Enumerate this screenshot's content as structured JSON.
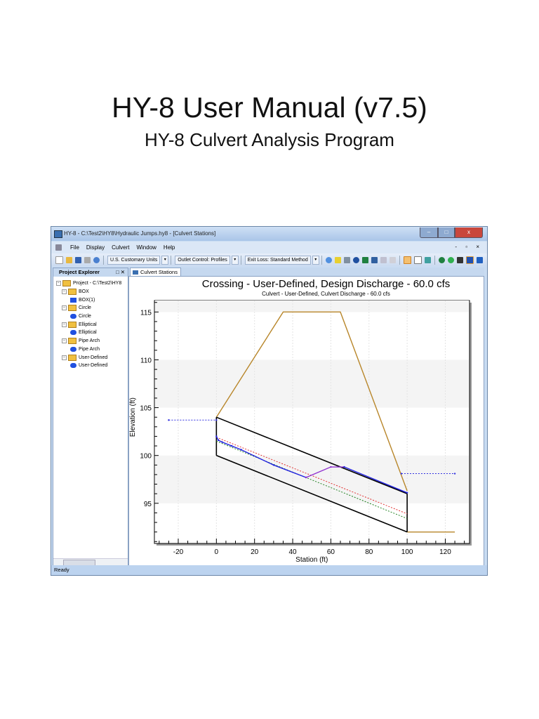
{
  "document": {
    "title": "HY-8 User Manual (v7.5)",
    "subtitle": "HY-8 Culvert Analysis Program"
  },
  "window": {
    "title": "HY-8 - C:\\Test2\\HY8\\Hydraulic Jumps.hy8 - [Culvert Stations]",
    "controls": [
      "minimize",
      "maximize",
      "close"
    ]
  },
  "menu": [
    "File",
    "Display",
    "Culvert",
    "Window",
    "Help"
  ],
  "toolbar": {
    "units": "U.S. Customary Units",
    "profiles": "Outlet Control: Profiles",
    "exit_loss": "Exit Loss: Standard Method"
  },
  "explorer": {
    "title": "Project Explorer",
    "items": [
      {
        "label": "Project - C:\\Test2\\HY8",
        "level": 0,
        "type": "folder"
      },
      {
        "label": "BOX",
        "level": 1,
        "type": "folder"
      },
      {
        "label": "BOX(1)",
        "level": 2,
        "type": "box"
      },
      {
        "label": "Circle",
        "level": 1,
        "type": "folder"
      },
      {
        "label": "Circle",
        "level": 2,
        "type": "ball"
      },
      {
        "label": "Elliptical",
        "level": 1,
        "type": "folder"
      },
      {
        "label": "Elliptical",
        "level": 2,
        "type": "ball"
      },
      {
        "label": "Pipe Arch",
        "level": 1,
        "type": "folder"
      },
      {
        "label": "Pipe Arch",
        "level": 2,
        "type": "ball"
      },
      {
        "label": "User-Defined",
        "level": 1,
        "type": "folder"
      },
      {
        "label": "User-Defined",
        "level": 2,
        "type": "ball"
      }
    ]
  },
  "tab": "Culvert Stations",
  "status": "Ready",
  "chart_data": {
    "type": "line",
    "title": "Crossing - User-Defined, Design Discharge - 60.0 cfs",
    "subtitle": "Culvert - User-Defined, Culvert Discharge - 60.0 cfs",
    "xlabel": "Station (ft)",
    "ylabel": "Elevation (ft)",
    "xlim": [
      -32.5,
      132.7
    ],
    "ylim": [
      90.8,
      116.2
    ],
    "xticks": [
      -20,
      0,
      20,
      40,
      60,
      80,
      100,
      120
    ],
    "yticks": [
      95,
      100,
      105,
      110,
      115
    ],
    "series": [
      {
        "name": "embankment",
        "color": "#b8862a",
        "dash": "",
        "points": [
          [
            0,
            104
          ],
          [
            35,
            115
          ],
          [
            65,
            115
          ],
          [
            100,
            96.3
          ]
        ]
      },
      {
        "name": "tailwater-ground",
        "color": "#b8862a",
        "dash": "",
        "points": [
          [
            100,
            92
          ],
          [
            125,
            92
          ]
        ]
      },
      {
        "name": "culvert-top",
        "color": "#000000",
        "dash": "",
        "points": [
          [
            0,
            104
          ],
          [
            100,
            96
          ]
        ]
      },
      {
        "name": "culvert-bottom",
        "color": "#000000",
        "dash": "",
        "points": [
          [
            0,
            100
          ],
          [
            100,
            92
          ]
        ]
      },
      {
        "name": "culvert-inlet",
        "color": "#000000",
        "dash": "",
        "points": [
          [
            0,
            104
          ],
          [
            0,
            100
          ]
        ]
      },
      {
        "name": "culvert-outlet",
        "color": "#000000",
        "dash": "",
        "points": [
          [
            100,
            96
          ],
          [
            100,
            92
          ]
        ]
      },
      {
        "name": "critical-depth",
        "color": "#e03030",
        "dash": "2,2",
        "points": [
          [
            0,
            101.9
          ],
          [
            100,
            93.9
          ]
        ]
      },
      {
        "name": "normal-depth",
        "color": "#208020",
        "dash": "2,2",
        "points": [
          [
            0,
            101.5
          ],
          [
            100,
            93.4
          ]
        ]
      },
      {
        "name": "water-surface-upstream",
        "color": "#2020e0",
        "dash": "",
        "points": [
          [
            0,
            102
          ],
          [
            1,
            101.6
          ],
          [
            3,
            101.4
          ],
          [
            8,
            101
          ],
          [
            13,
            100.6
          ],
          [
            30,
            99
          ],
          [
            47,
            97.7
          ]
        ]
      },
      {
        "name": "hydraulic-jump",
        "color": "#9030d0",
        "dash": "",
        "points": [
          [
            47,
            97.7
          ],
          [
            60,
            98.8
          ],
          [
            67,
            98.8
          ]
        ]
      },
      {
        "name": "water-surface-downstream",
        "color": "#2020e0",
        "dash": "",
        "points": [
          [
            67,
            98.8
          ],
          [
            100,
            96.1
          ]
        ]
      },
      {
        "name": "headwater",
        "color": "#3030e0",
        "dash": "2,2",
        "points": [
          [
            -25,
            103.7
          ],
          [
            0,
            103.7
          ]
        ]
      },
      {
        "name": "tailwater",
        "color": "#3030e0",
        "dash": "2,2",
        "points": [
          [
            97,
            98.1
          ],
          [
            125,
            98.1
          ]
        ]
      }
    ]
  }
}
